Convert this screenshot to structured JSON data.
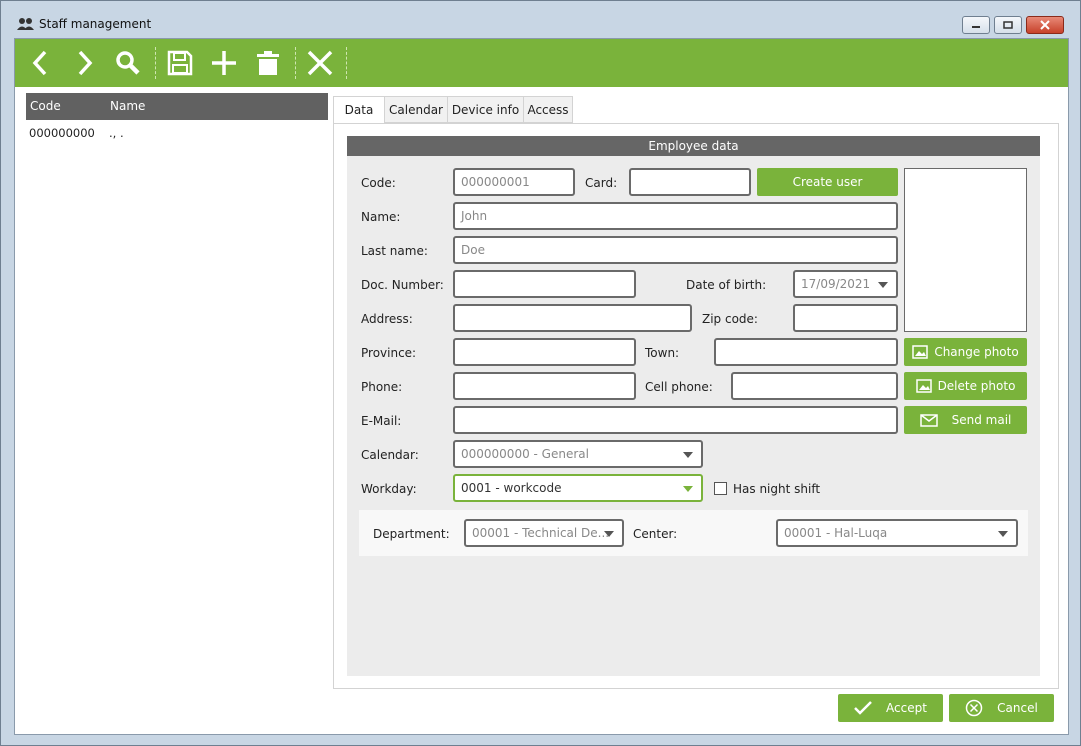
{
  "window": {
    "title": "Staff management",
    "icon": "users-icon"
  },
  "toolbar": {
    "buttons": [
      {
        "name": "previous",
        "icon": "chevron-left-icon"
      },
      {
        "name": "next",
        "icon": "chevron-right-icon"
      },
      {
        "name": "search",
        "icon": "search-icon"
      },
      {
        "name": "save",
        "icon": "floppy-disk-icon"
      },
      {
        "name": "add",
        "icon": "plus-icon"
      },
      {
        "name": "delete",
        "icon": "trash-icon"
      },
      {
        "name": "close",
        "icon": "x-icon"
      }
    ]
  },
  "list": {
    "headers": [
      "Code",
      "Name"
    ],
    "rows": [
      {
        "code": "000000000",
        "name": "., ."
      }
    ]
  },
  "tabs": [
    "Data",
    "Calendar",
    "Device info",
    "Access"
  ],
  "form": {
    "section_title": "Employee data",
    "labels": {
      "code": "Code:",
      "card": "Card:",
      "name": "Name:",
      "last_name": "Last name:",
      "doc_number": "Doc. Number:",
      "date_of_birth": "Date of birth:",
      "address": "Address:",
      "zip_code": "Zip code:",
      "province": "Province:",
      "town": "Town:",
      "phone": "Phone:",
      "cell_phone": "Cell phone:",
      "email": "E-Mail:",
      "calendar": "Calendar:",
      "workday": "Workday:",
      "night_shift": "Has night shift",
      "department": "Department:",
      "center": "Center:"
    },
    "values": {
      "code": "000000001",
      "card": "",
      "name": "John",
      "last_name": "Doe",
      "doc_number": "",
      "date_of_birth": "17/09/2021",
      "address": "",
      "zip_code": "",
      "province": "",
      "town": "",
      "phone": "",
      "cell_phone": "",
      "email": "",
      "calendar": "000000000 - General",
      "workday": "0001 - workcode",
      "department": "00001 - Technical De...",
      "center": "00001 - Hal-Luqa",
      "night_shift_checked": false
    },
    "buttons": {
      "create_user": "Create user",
      "change_photo": "Change photo",
      "delete_photo": "Delete photo",
      "send_mail": "Send mail"
    }
  },
  "footer": {
    "accept": "Accept",
    "cancel": "Cancel"
  },
  "colors": {
    "accent": "#7ab33b",
    "header_dark": "#616161",
    "section_bg": "#ececec"
  }
}
